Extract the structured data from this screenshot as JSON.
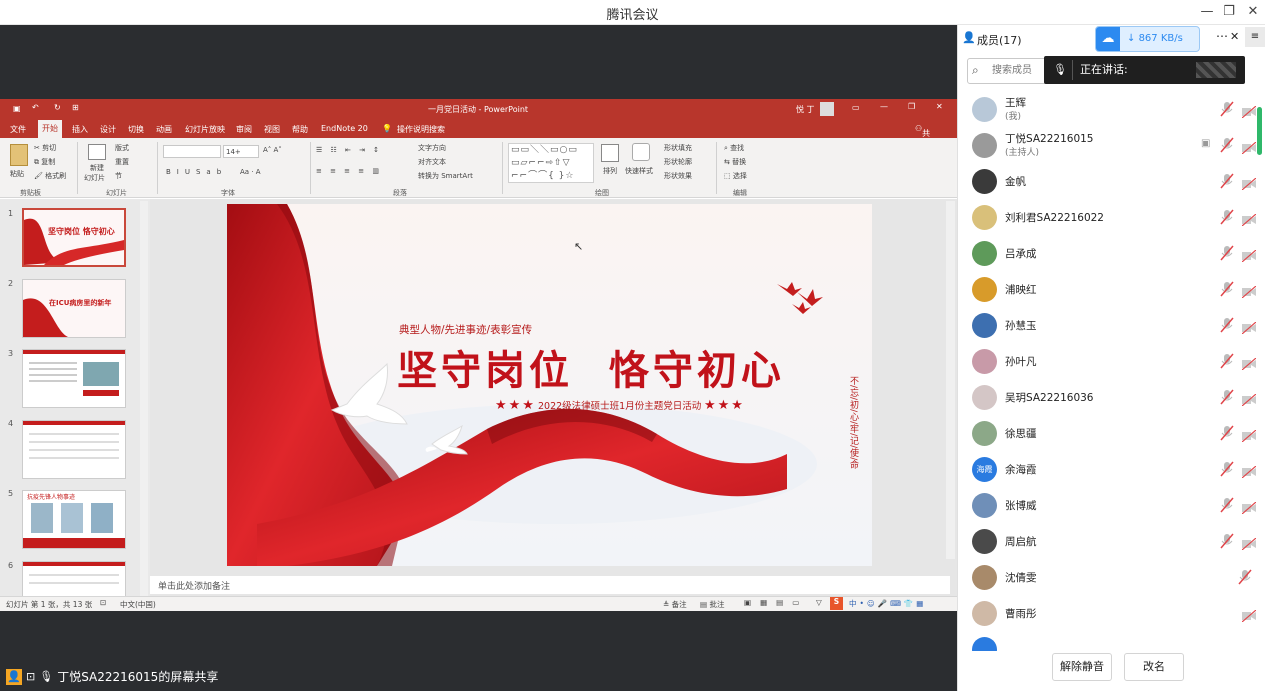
{
  "window": {
    "title": "腾讯会议"
  },
  "ppt": {
    "doc_title": "一月党日活动 - PowerPoint",
    "user": "悦 丁",
    "share_btn": "共享",
    "tabs": [
      "文件",
      "开始",
      "插入",
      "设计",
      "切换",
      "动画",
      "幻灯片放映",
      "审阅",
      "视图",
      "帮助",
      "EndNote 20",
      "操作说明搜索"
    ],
    "groups": [
      "剪贴板",
      "幻灯片",
      "字体",
      "段落",
      "绘图",
      "编辑"
    ],
    "clipboard": {
      "paste": "粘贴",
      "cut": "剪切",
      "copy": "复制",
      "painter": "格式刷"
    },
    "slides_grp": {
      "new": "新建",
      "new2": "幻灯片",
      "layout": "版式",
      "reset": "重置",
      "section": "节"
    },
    "font_size": "14+",
    "para": {
      "dir": "文字方向",
      "align": "对齐文本",
      "smart": "转换为 SmartArt"
    },
    "draw": {
      "arrange": "排列",
      "quick": "快速样式",
      "fill": "形状填充",
      "outline": "形状轮廓",
      "effect": "形状效果"
    },
    "edit": {
      "find": "查找",
      "replace": "替换",
      "select": "选择"
    },
    "slide_nums": [
      "1",
      "2",
      "3",
      "4",
      "5",
      "6"
    ],
    "thumb1": "坚守岗位 恪守初心",
    "thumb2": "在ICU病房里的新年",
    "thumb5": "抗疫先锋人物事迹",
    "slide": {
      "subtitle": "典型人物/先进事迹/表彰宣传",
      "title": "坚守岗位  恪守初心",
      "event": "2022级法律硕士班1月份主题党日活动",
      "vertical": "不/忘/初/心/牢/记/使/命"
    },
    "notes": "单击此处添加备注",
    "status": {
      "slide": "幻灯片 第 1 张，共 13 张",
      "lang": "中文(中国)",
      "notes": "备注",
      "comments": "批注"
    }
  },
  "share_label": "丁悦SA22216015的屏幕共享",
  "panel": {
    "title": "成员(17)",
    "speed": "867 KB/s",
    "search_placeholder": "搜索成员",
    "speaking": "正在讲话:",
    "members": [
      {
        "name": "王辉",
        "sub": "(我)"
      },
      {
        "name": "丁悦SA22216015",
        "sub": "(主持人)"
      },
      {
        "name": "金帆",
        "sub": ""
      },
      {
        "name": "刘利君SA22216022",
        "sub": ""
      },
      {
        "name": "吕承成",
        "sub": ""
      },
      {
        "name": "浦映红",
        "sub": ""
      },
      {
        "name": "孙慧玉",
        "sub": ""
      },
      {
        "name": "孙叶凡",
        "sub": ""
      },
      {
        "name": "吴玥SA22216036",
        "sub": ""
      },
      {
        "name": "徐思疆",
        "sub": ""
      },
      {
        "name": "余海霞",
        "sub": ""
      },
      {
        "name": "张博威",
        "sub": ""
      },
      {
        "name": "周启航",
        "sub": ""
      },
      {
        "name": "沈倩雯",
        "sub": ""
      },
      {
        "name": "曹雨彤",
        "sub": ""
      }
    ],
    "avatar_text_11": "海霞",
    "unmute": "解除静音",
    "rename": "改名"
  }
}
